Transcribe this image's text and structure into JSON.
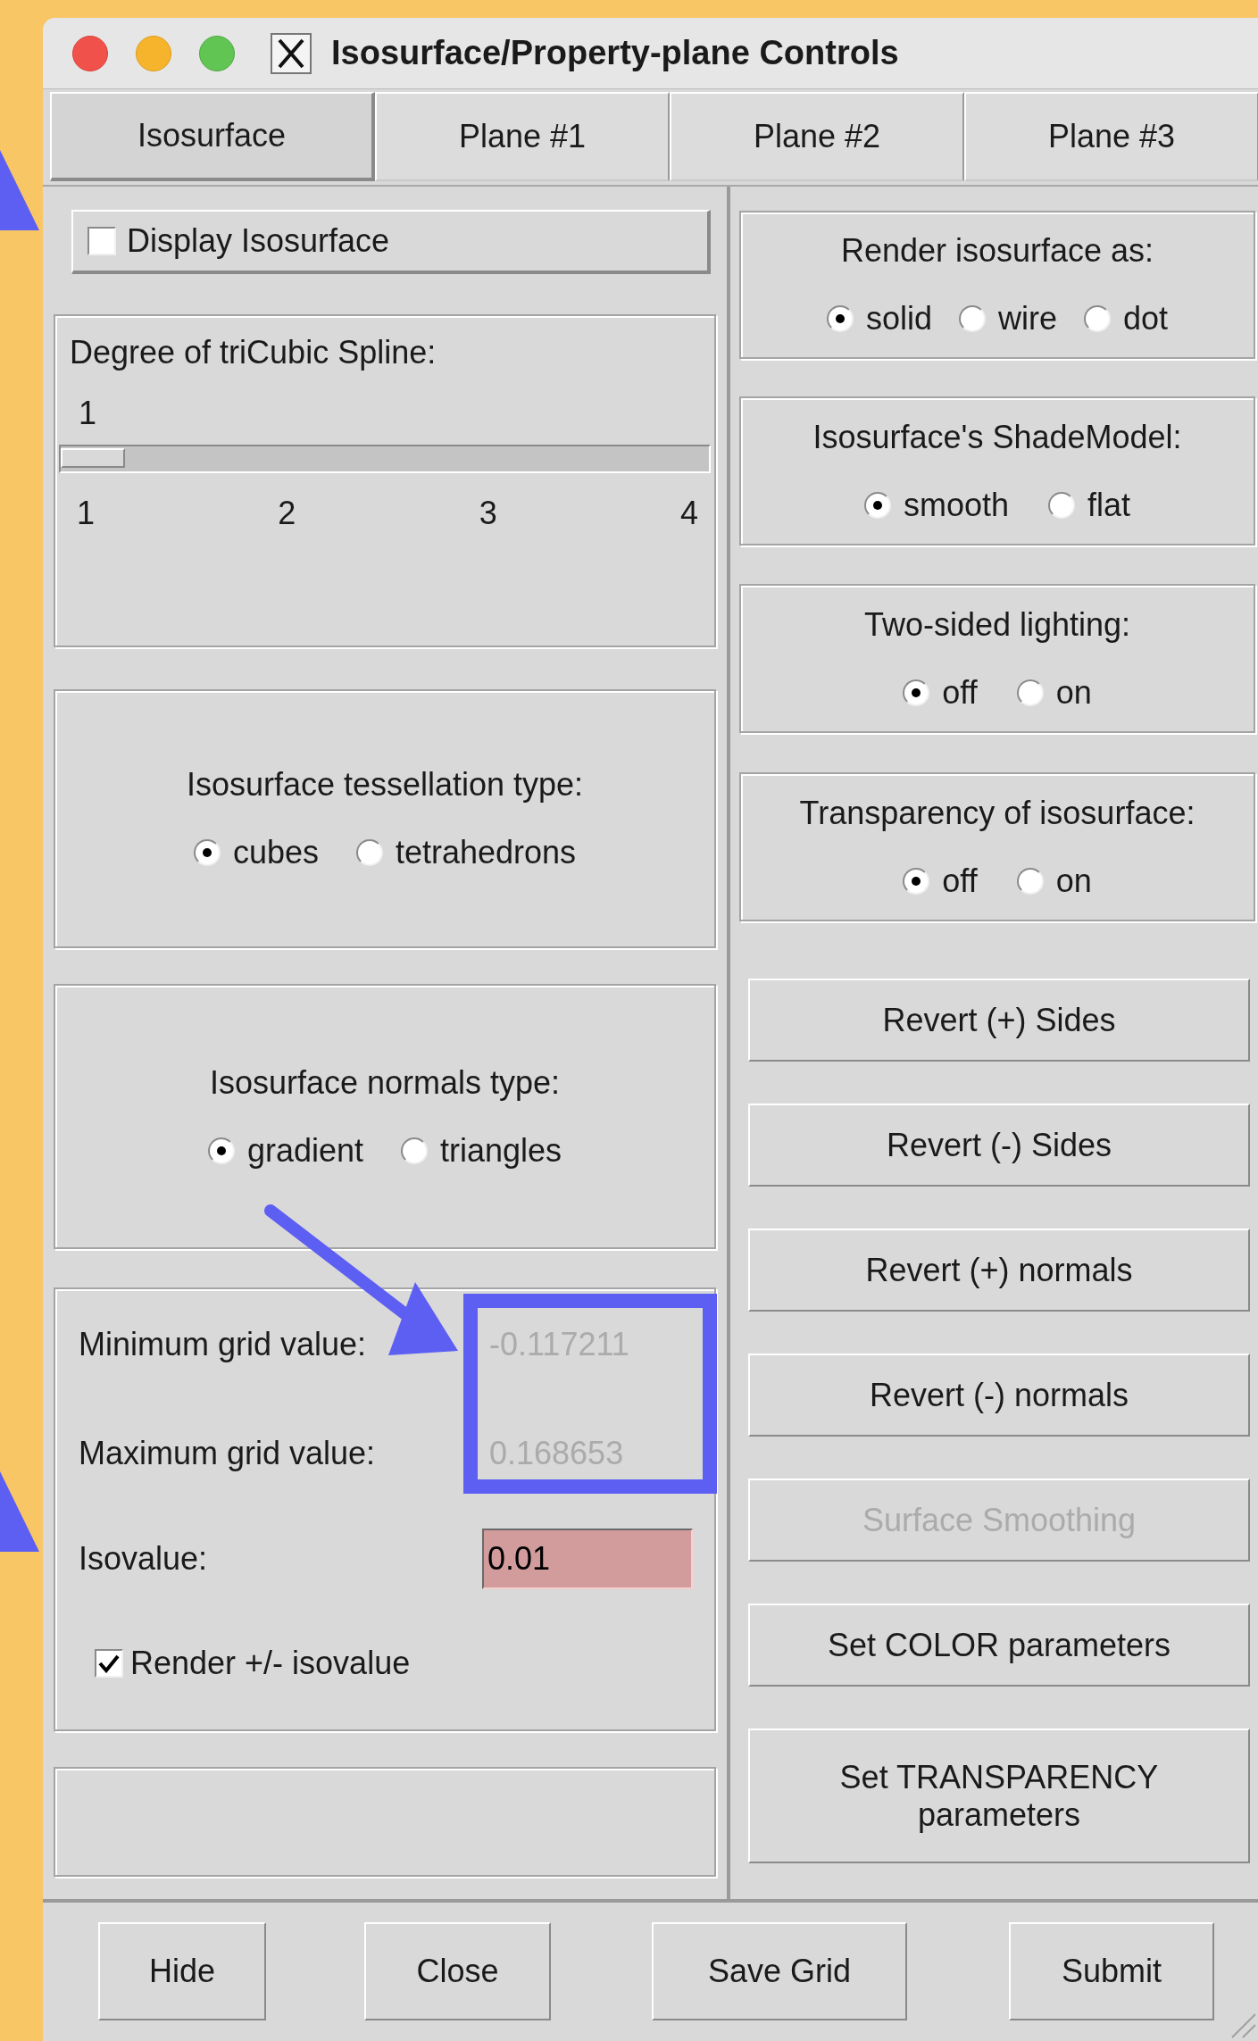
{
  "window": {
    "title": "Isosurface/Property-plane Controls"
  },
  "tabs": [
    {
      "label": "Isosurface",
      "selected": true
    },
    {
      "label": "Plane #1",
      "selected": false
    },
    {
      "label": "Plane #2",
      "selected": false
    },
    {
      "label": "Plane #3",
      "selected": false
    }
  ],
  "display_isosurface": {
    "label": "Display Isosurface",
    "checked": false
  },
  "spline": {
    "label": "Degree of triCubic Spline:",
    "value": "1",
    "level": 0,
    "ticks": [
      "1",
      "2",
      "3",
      "4"
    ]
  },
  "tessellation": {
    "label": "Isosurface tessellation type:",
    "options": [
      {
        "label": "cubes",
        "selected": true
      },
      {
        "label": "tetrahedrons",
        "selected": false
      }
    ]
  },
  "normals": {
    "label": "Isosurface normals type:",
    "options": [
      {
        "label": "gradient",
        "selected": true
      },
      {
        "label": "triangles",
        "selected": false
      }
    ]
  },
  "grid": {
    "min_label": "Minimum grid value:",
    "min_value": "-0.117211",
    "max_label": "Maximum grid value:",
    "max_value": "0.168653",
    "isovalue_label": "Isovalue:",
    "isovalue": "0.01",
    "render_pm": {
      "label": "Render +/- isovalue",
      "checked": true
    }
  },
  "render_as": {
    "label": "Render isosurface as:",
    "options": [
      {
        "label": "solid",
        "selected": true
      },
      {
        "label": "wire",
        "selected": false
      },
      {
        "label": "dot",
        "selected": false
      }
    ]
  },
  "shade_model": {
    "label": "Isosurface's ShadeModel:",
    "options": [
      {
        "label": "smooth",
        "selected": true
      },
      {
        "label": "flat",
        "selected": false
      }
    ]
  },
  "two_sided": {
    "label": "Two-sided lighting:",
    "options": [
      {
        "label": "off",
        "selected": true
      },
      {
        "label": "on",
        "selected": false
      }
    ]
  },
  "transparency": {
    "label": "Transparency of isosurface:",
    "options": [
      {
        "label": "off",
        "selected": true
      },
      {
        "label": "on",
        "selected": false
      }
    ]
  },
  "buttons": [
    {
      "label": "Revert (+) Sides",
      "disabled": false
    },
    {
      "label": "Revert (-) Sides",
      "disabled": false
    },
    {
      "label": "Revert (+) normals",
      "disabled": false
    },
    {
      "label": "Revert (-) normals",
      "disabled": false
    },
    {
      "label": "Surface Smoothing",
      "disabled": true
    },
    {
      "label": "Set COLOR parameters",
      "disabled": false
    },
    {
      "label": "Set TRANSPARENCY parameters",
      "disabled": false
    }
  ],
  "footer_buttons": [
    "Hide",
    "Close",
    "Save Grid",
    "Submit"
  ]
}
